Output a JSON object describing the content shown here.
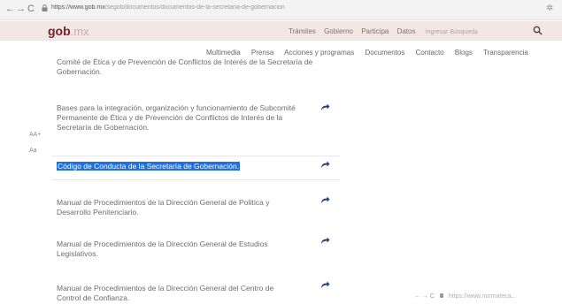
{
  "browser": {
    "back_glyph": "←",
    "forward_glyph": "→",
    "reload_glyph": "C",
    "url_host": "https://www.gob.mx",
    "url_path": "/segob/documentos/documentos-de-la-secretaria-de-gobernacion",
    "extension_glyph": "✲"
  },
  "header": {
    "logo_main": "gob",
    "logo_tld": ".mx",
    "nav": [
      "Trámites",
      "Gobierno",
      "Participa",
      "Datos"
    ],
    "search_placeholder": "Ingresar Búsqueda"
  },
  "subnav": [
    "Multimedia",
    "Prensa",
    "Acciones y programas",
    "Documentos",
    "Contacto",
    "Blogs",
    "Transparencia"
  ],
  "font_controls": {
    "increase": "AA+",
    "decrease": "Aa"
  },
  "documents": [
    {
      "title": "Comité de Ética y de Prevención de Conflictos de Interés de la Secretaría de Gobernación."
    },
    {
      "title": "Bases para la integración, organización y funcionamiento de Subcomité Permanente de Ética y de Prevención de Conflictos de Interés de la Secretaría de Gobernación."
    },
    {
      "title": "Código de Conducta de la Secretaría de Gobernación."
    },
    {
      "title": "Manual de Procedimientos de la Dirección General de Política y Desarrollo Penitenciario."
    },
    {
      "title": "Manual de Procedimientos de la Dirección General de Estudios Legislativos."
    },
    {
      "title": "Manual de Procedimientos de la Dirección General del Centro de Control de Confianza."
    }
  ],
  "mini_address": {
    "glyphs": "←  →  C",
    "url": "https://www.normateca..."
  },
  "colors": {
    "brand": "#7a1e2b",
    "header_bg": "#f3e7e3",
    "selection": "#1f6fe0",
    "share_icon": "#1a3f7a"
  }
}
